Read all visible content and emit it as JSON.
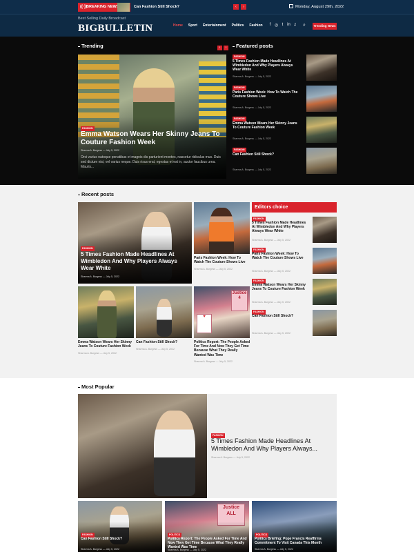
{
  "topbar": {
    "breaking_label": "BREAKING NEWS",
    "breaking_title": "Can Fashion Still Shock?",
    "date": "Monday, August 29th, 2022",
    "prev_glyph": "‹",
    "next_glyph": "›"
  },
  "header": {
    "tagline": "Best Selling Daily Broadcast",
    "logo": "BIGBULLETIN",
    "nav": [
      "Home",
      "Sport",
      "Entertainment",
      "Politics",
      "Fashion"
    ],
    "social_icons": [
      "f",
      "◎",
      "t",
      "in",
      "♫"
    ],
    "trending_button": "Trending News"
  },
  "trending": {
    "title": "Trending",
    "hero": {
      "category": "FASHION",
      "title": "Emma Watson Wears Her Skinny Jeans To Couture Fashion Week",
      "author": "Sharma A. Burgess",
      "date": "July 5, 2022",
      "excerpt": "Orci varius natoque penatibus et magnis dis parturient montes, nascetur ridiculus mus. Duis sed dictum nisi, vel varius neque. Duis risus erat, egestas et est in, auctor faucibus urna. Mauris..."
    }
  },
  "featured": {
    "title": "Featured posts",
    "items": [
      {
        "category": "FASHION",
        "title": "5 Times Fashion Made Headlines At Wimbledon And Why Players Always Wear White",
        "author": "Sharma A. Burgess",
        "date": "July 5, 2022"
      },
      {
        "category": "FASHION",
        "title": "Paris Fashion Week: How To Watch The Couture Shows Live",
        "author": "Sharma A. Burgess",
        "date": "July 5, 2022"
      },
      {
        "category": "FASHION",
        "title": "Emma Watson Wears Her Skinny Jeans To Couture Fashion Week",
        "author": "Sharma A. Burgess",
        "date": "July 5, 2022"
      },
      {
        "category": "FASHION",
        "title": "Can Fashion Still Shock?",
        "author": "Sharma A. Burgess",
        "date": "July 5, 2022"
      }
    ]
  },
  "recent": {
    "title": "Recent posts",
    "big": {
      "category": "FASHION",
      "title": "5 Times Fashion Made Headlines At Wimbledon And Why Players Always Wear White",
      "author": "Sharma A. Burgess",
      "date": "July 5, 2022"
    },
    "small": [
      {
        "title": "Paris Fashion Week: How To Watch The Couture Shows Live",
        "author": "Sharma A. Burgess",
        "date": "July 5, 2022"
      },
      {
        "title": "Emma Watson Wears Her Skinny Jeans To Couture Fashion Week",
        "author": "Sharma A. Burgess",
        "date": "July 5, 2022"
      },
      {
        "title": "Can Fashion Still Shock?",
        "author": "Sharma A. Burgess",
        "date": "July 5, 2022"
      },
      {
        "title": "Politics Report: The People Asked For Time And Now They Get Time Because What They Really Wanted Was Time",
        "author": "Sharma A. Burgess",
        "date": "July 5, 2022"
      }
    ],
    "sign_texts": [
      "Justice 4",
      "♥"
    ]
  },
  "editors": {
    "title": "Editors choice",
    "items": [
      {
        "category": "FASHION",
        "title": "5 Times Fashion Made Headlines At Wimbledon And Why Players Always Wear White",
        "author": "Sharma A. Burgess",
        "date": "July 5, 2022"
      },
      {
        "category": "FASHION",
        "title": "Paris Fashion Week: How To Watch The Couture Shows Live",
        "author": "Sharma A. Burgess",
        "date": "July 5, 2022"
      },
      {
        "category": "FASHION",
        "title": "Emma Watson Wears Her Skinny Jeans To Couture Fashion Week",
        "author": "Sharma A. Burgess",
        "date": "July 5, 2022"
      },
      {
        "category": "FASHION",
        "title": "Can Fashion Still Shock?",
        "author": "Sharma A. Burgess",
        "date": "July 5, 2022"
      }
    ]
  },
  "popular": {
    "title": "Most Popular",
    "main": {
      "category": "FASHION",
      "title": "5 Times Fashion Made Headlines At Wimbledon And Why Players Always...",
      "author": "Sharma A. Burgess",
      "date": "July 5, 2022"
    },
    "bottom": [
      {
        "category": "FASHION",
        "title": "Can Fashion Still Shock?",
        "author": "Sharma A. Burgess",
        "date": "July 5, 2022"
      },
      {
        "category": "POLITICS",
        "title": "Politics Report: The People Asked For Time And Now They Get Time Because What They Really Wanted Was Time",
        "author": "Sharma A. Burgess",
        "date": "July 5, 2022"
      },
      {
        "category": "POLITICS",
        "title": "Politics Briefing: Pope Francis Reaffirms Commitment To Visit Canada This Month",
        "author": "Sharma A. Burgess",
        "date": "July 5, 2022"
      }
    ],
    "sign_text": "Justice ALL"
  },
  "colors": {
    "accent": "#d9232c",
    "header_bg": "#0e2a44",
    "dark_bg": "#0b0b0b",
    "light_bg": "#f2f2f2"
  }
}
